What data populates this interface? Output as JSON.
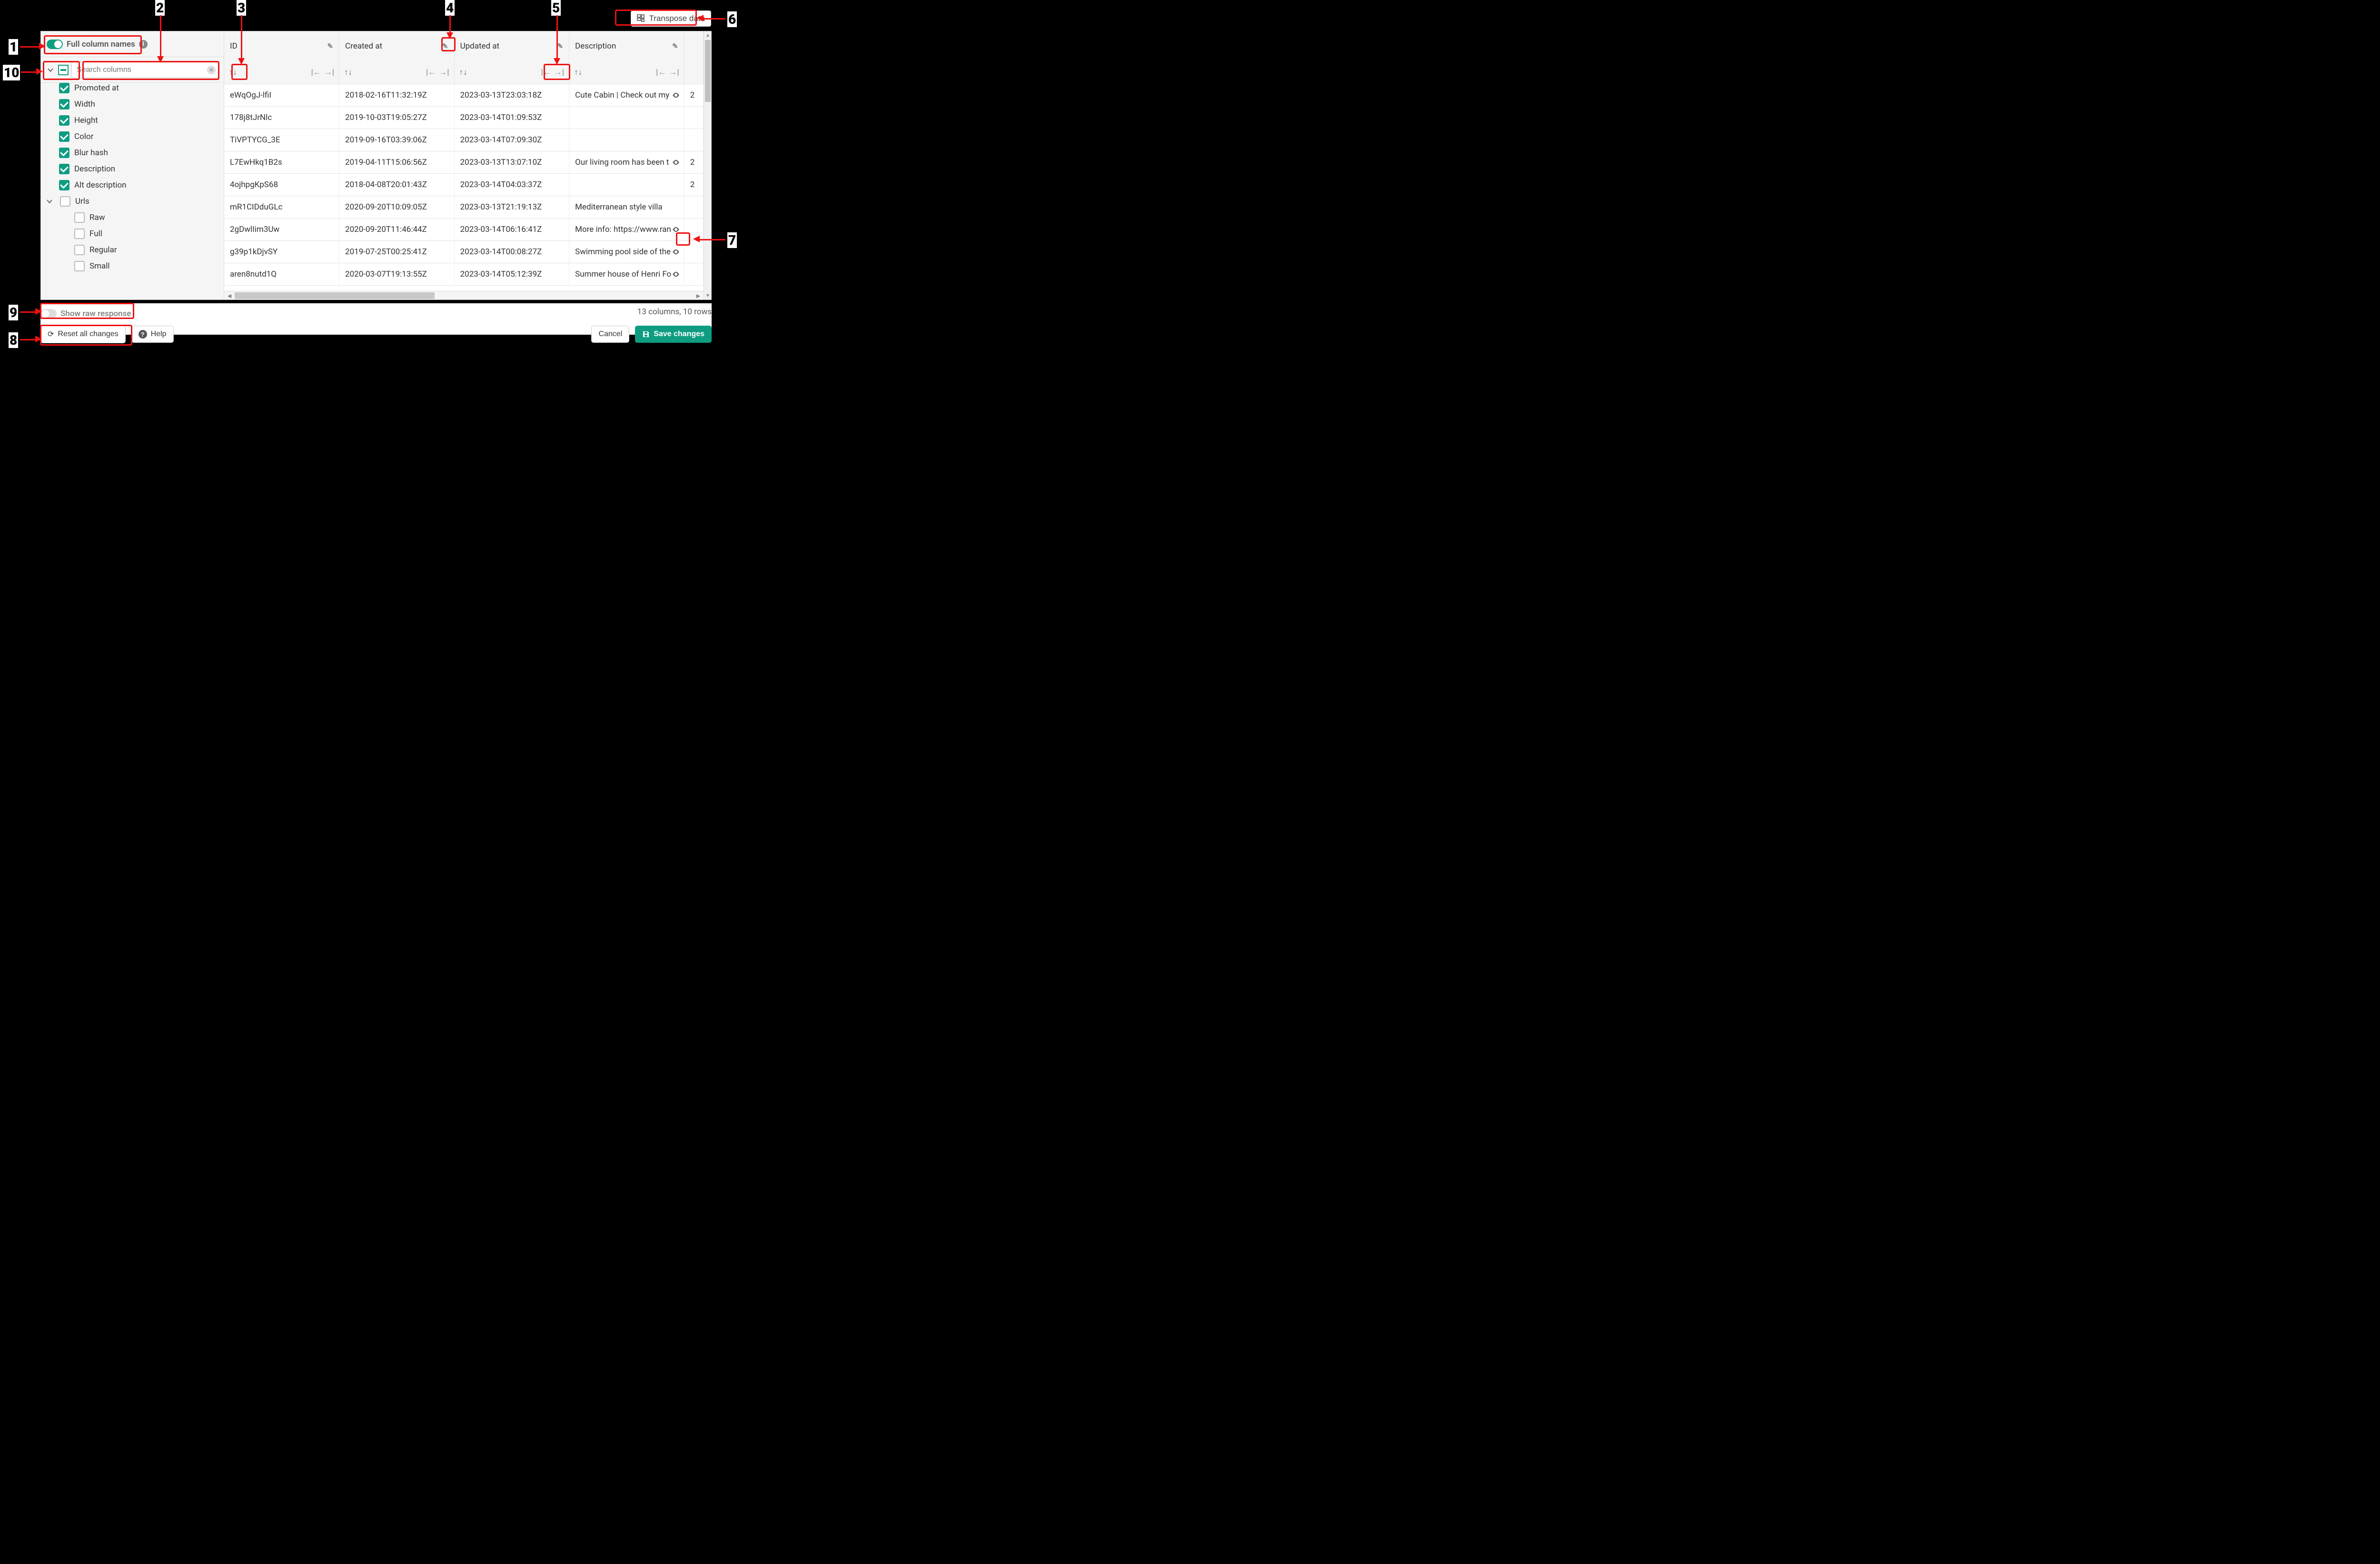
{
  "topbar": {
    "transpose_label": "Transpose data"
  },
  "sidebar": {
    "full_col_toggle_label": "Full column names",
    "search_placeholder": "Search columns",
    "items": [
      {
        "label": "Promoted at",
        "checked": true,
        "indent": "col"
      },
      {
        "label": "Width",
        "checked": true,
        "indent": "col"
      },
      {
        "label": "Height",
        "checked": true,
        "indent": "col"
      },
      {
        "label": "Color",
        "checked": true,
        "indent": "col"
      },
      {
        "label": "Blur hash",
        "checked": true,
        "indent": "col"
      },
      {
        "label": "Description",
        "checked": true,
        "indent": "col"
      },
      {
        "label": "Alt description",
        "checked": true,
        "indent": "col"
      },
      {
        "label": "Urls",
        "checked": false,
        "indent": "parent"
      },
      {
        "label": "Raw",
        "checked": false,
        "indent": "child"
      },
      {
        "label": "Full",
        "checked": false,
        "indent": "child"
      },
      {
        "label": "Regular",
        "checked": false,
        "indent": "child"
      },
      {
        "label": "Small",
        "checked": false,
        "indent": "child"
      }
    ]
  },
  "grid": {
    "columns": [
      "ID",
      "Created at",
      "Updated at",
      "Description"
    ],
    "rows": [
      {
        "id": "eWqOgJ-lfiI",
        "created": "2018-02-16T11:32:19Z",
        "updated": "2023-03-13T23:03:18Z",
        "desc": "Cute Cabin | Check out my",
        "eye": true,
        "extra": "2"
      },
      {
        "id": "178j8tJrNlc",
        "created": "2019-10-03T19:05:27Z",
        "updated": "2023-03-14T01:09:53Z",
        "desc": "",
        "eye": false,
        "extra": ""
      },
      {
        "id": "TiVPTYCG_3E",
        "created": "2019-09-16T03:39:06Z",
        "updated": "2023-03-14T07:09:30Z",
        "desc": "",
        "eye": false,
        "extra": ""
      },
      {
        "id": "L7EwHkq1B2s",
        "created": "2019-04-11T15:06:56Z",
        "updated": "2023-03-13T13:07:10Z",
        "desc": "Our living room has been t",
        "eye": true,
        "extra": "2"
      },
      {
        "id": "4ojhpgKpS68",
        "created": "2018-04-08T20:01:43Z",
        "updated": "2023-03-14T04:03:37Z",
        "desc": "",
        "eye": false,
        "extra": "2"
      },
      {
        "id": "mR1CIDduGLc",
        "created": "2020-09-20T10:09:05Z",
        "updated": "2023-03-13T21:19:13Z",
        "desc": "Mediterranean style villa",
        "eye": false,
        "extra": ""
      },
      {
        "id": "2gDwlIim3Uw",
        "created": "2020-09-20T11:46:44Z",
        "updated": "2023-03-14T06:16:41Z",
        "desc": "More info: https://www.ran",
        "eye": true,
        "extra": ""
      },
      {
        "id": "g39p1kDjvSY",
        "created": "2019-07-25T00:25:41Z",
        "updated": "2023-03-14T00:08:27Z",
        "desc": "Swimming pool side of the",
        "eye": true,
        "extra": ""
      },
      {
        "id": "aren8nutd1Q",
        "created": "2020-03-07T19:13:55Z",
        "updated": "2023-03-14T05:12:39Z",
        "desc": "Summer house of Henri Fo",
        "eye": true,
        "extra": ""
      }
    ]
  },
  "footer": {
    "raw_label": "Show raw response",
    "status": "13 columns, 10 rows",
    "reset_label": "Reset all changes",
    "help_label": "Help",
    "cancel_label": "Cancel",
    "save_label": "Save changes"
  },
  "callouts": {
    "n1": "1",
    "n2": "2",
    "n3": "3",
    "n4": "4",
    "n5": "5",
    "n6": "6",
    "n7": "7",
    "n8": "8",
    "n9": "9",
    "n10": "10"
  }
}
